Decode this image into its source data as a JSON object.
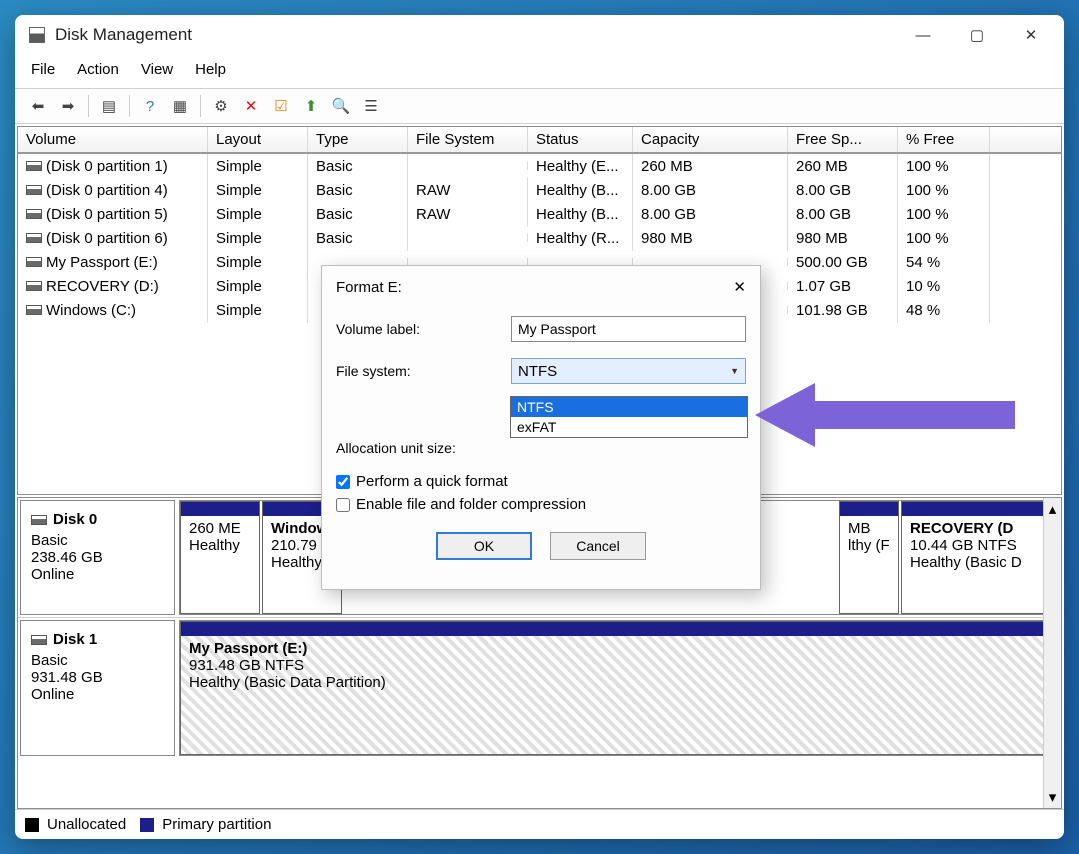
{
  "window": {
    "title": "Disk Management"
  },
  "menu": {
    "file": "File",
    "action": "Action",
    "view": "View",
    "help": "Help"
  },
  "columns": {
    "volume": "Volume",
    "layout": "Layout",
    "type": "Type",
    "fs": "File System",
    "status": "Status",
    "capacity": "Capacity",
    "free": "Free Sp...",
    "pct": "% Free"
  },
  "rows": [
    {
      "v": "(Disk 0 partition 1)",
      "l": "Simple",
      "t": "Basic",
      "fs": "",
      "s": "Healthy (E...",
      "c": "260 MB",
      "f": "260 MB",
      "p": "100 %"
    },
    {
      "v": "(Disk 0 partition 4)",
      "l": "Simple",
      "t": "Basic",
      "fs": "RAW",
      "s": "Healthy (B...",
      "c": "8.00 GB",
      "f": "8.00 GB",
      "p": "100 %"
    },
    {
      "v": "(Disk 0 partition 5)",
      "l": "Simple",
      "t": "Basic",
      "fs": "RAW",
      "s": "Healthy (B...",
      "c": "8.00 GB",
      "f": "8.00 GB",
      "p": "100 %"
    },
    {
      "v": "(Disk 0 partition 6)",
      "l": "Simple",
      "t": "Basic",
      "fs": "",
      "s": "Healthy (R...",
      "c": "980 MB",
      "f": "980 MB",
      "p": "100 %"
    },
    {
      "v": "My Passport (E:)",
      "l": "Simple",
      "t": "",
      "fs": "",
      "s": "",
      "c": "",
      "f": "500.00 GB",
      "p": "54 %"
    },
    {
      "v": "RECOVERY (D:)",
      "l": "Simple",
      "t": "",
      "fs": "",
      "s": "",
      "c": "",
      "f": "1.07 GB",
      "p": "10 %"
    },
    {
      "v": "Windows (C:)",
      "l": "Simple",
      "t": "",
      "fs": "",
      "s": "",
      "c": "",
      "f": "101.98 GB",
      "p": "48 %"
    }
  ],
  "disk0": {
    "name": "Disk 0",
    "type": "Basic",
    "size": "238.46 GB",
    "state": "Online",
    "parts": [
      {
        "n": "",
        "sz": "260 ME",
        "st": "Healthy"
      },
      {
        "n": "Window",
        "sz": "210.79 G",
        "st": "Healthy"
      },
      {
        "n": "",
        "sz": "",
        "st": ""
      },
      {
        "n": "",
        "sz": "MB",
        "st": "lthy (F"
      },
      {
        "n": "RECOVERY  (D",
        "sz": "10.44 GB NTFS",
        "st": "Healthy (Basic D"
      }
    ]
  },
  "disk1": {
    "name": "Disk 1",
    "type": "Basic",
    "size": "931.48 GB",
    "state": "Online",
    "part": {
      "n": "My Passport  (E:)",
      "sz": "931.48 GB NTFS",
      "st": "Healthy (Basic Data Partition)"
    }
  },
  "legend": {
    "unalloc": "Unallocated",
    "primary": "Primary partition"
  },
  "dialog": {
    "title": "Format E:",
    "volLabel": "Volume label:",
    "volValue": "My Passport",
    "fsLabel": "File system:",
    "fsValue": "NTFS",
    "ausLabel": "Allocation unit size:",
    "options": {
      "opt1": "NTFS",
      "opt2": "exFAT"
    },
    "chk1": "Perform a quick format",
    "chk2": "Enable file and folder compression",
    "ok": "OK",
    "cancel": "Cancel"
  }
}
